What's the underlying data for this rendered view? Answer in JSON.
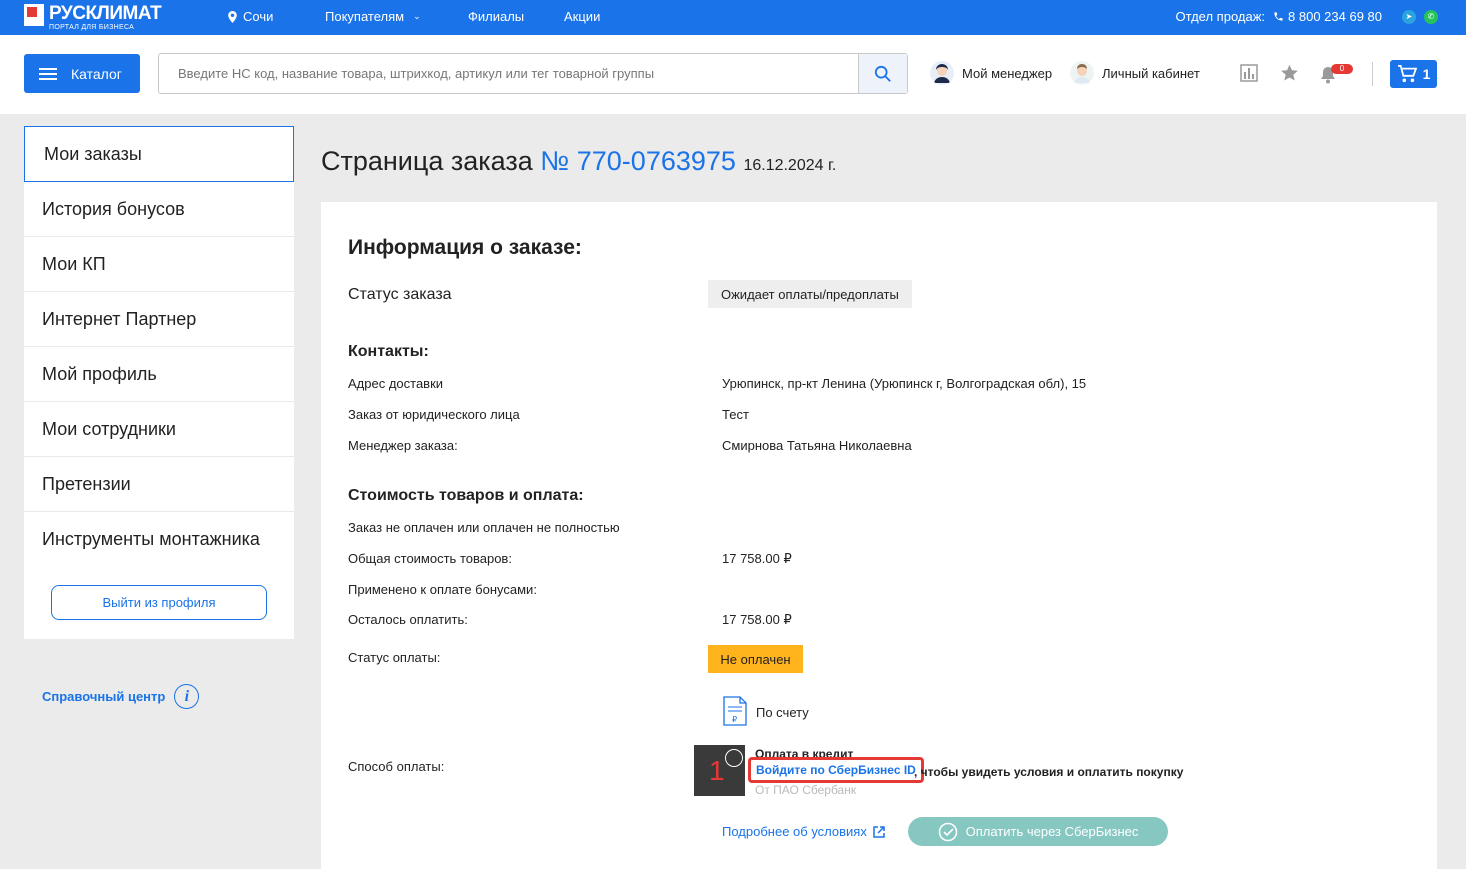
{
  "topbar": {
    "logo_name": "РУСКЛИМАТ",
    "logo_sub": "ПОРТАЛ ДЛЯ БИЗНЕСА",
    "city": "Сочи",
    "nav": [
      "Покупателям",
      "Филиалы",
      "Акции"
    ],
    "sales_label": "Отдел продаж:",
    "phone": "8 800 234 69 80"
  },
  "header": {
    "catalog_label": "Каталог",
    "search_placeholder": "Введите НС код, название товара, штрихкод, артикул или тег товарной группы",
    "manager_label": "Мой менеджер",
    "account_label": "Личный кабинет",
    "notifications_count": "0",
    "cart_count": "1"
  },
  "sidebar": {
    "items": [
      {
        "label": "Мои заказы",
        "active": true
      },
      {
        "label": "История бонусов"
      },
      {
        "label": "Мои КП"
      },
      {
        "label": "Интернет Партнер"
      },
      {
        "label": "Мой профиль"
      },
      {
        "label": "Мои сотрудники"
      },
      {
        "label": "Претензии"
      },
      {
        "label": "Инструменты монтажника"
      }
    ],
    "logout_label": "Выйти из профиля",
    "help_label": "Справочный центр"
  },
  "page": {
    "title": "Страница заказа",
    "order_number": "№ 770-0763975",
    "date": "16.12.2024 г."
  },
  "order": {
    "info_title": "Информация о заказе:",
    "status_label": "Статус заказа",
    "status_value": "Ожидает оплаты/предоплаты",
    "contacts_title": "Контакты:",
    "address_label": "Адрес доставки",
    "address_value": "Урюпинск, пр-кт Ленина (Урюпинск г, Волгоградская обл), 15",
    "legal_label": "Заказ от юридического лица",
    "legal_value": "Тест",
    "manager_label": "Менеджер заказа:",
    "manager_value": "Смирнова Татьяна Николаевна",
    "cost_title": "Стоимость товаров и оплата:",
    "not_paid_note": "Заказ не оплачен или оплачен не полностью",
    "total_label": "Общая стоимость товаров:",
    "total_value": "17 758.00 ₽",
    "bonus_label": "Применено к оплате бонусами:",
    "remaining_label": "Осталось оплатить:",
    "remaining_value": "17 758.00 ₽",
    "pay_status_label": "Статус оплаты:",
    "pay_status_value": "Не оплачен",
    "pay_method_label": "Способ оплаты:",
    "invoice_label": "По счету",
    "credit_title": "Оплата в кредит",
    "credit_marker": "1",
    "sber_login": "Войдите по СберБизнес ID",
    "sber_login_suffix": ", чтобы увидеть условия и оплатить покупку",
    "credit_provider": "От ПАО Сбербанк",
    "conditions_link": "Подробнее об условиях",
    "pay_button": "Оплатить через СберБизнес"
  },
  "colors": {
    "brand_blue": "#1a73e8",
    "unpaid_orange": "#ffb41e",
    "highlight_red": "#e53935",
    "sber_button": "#86c7c2"
  }
}
